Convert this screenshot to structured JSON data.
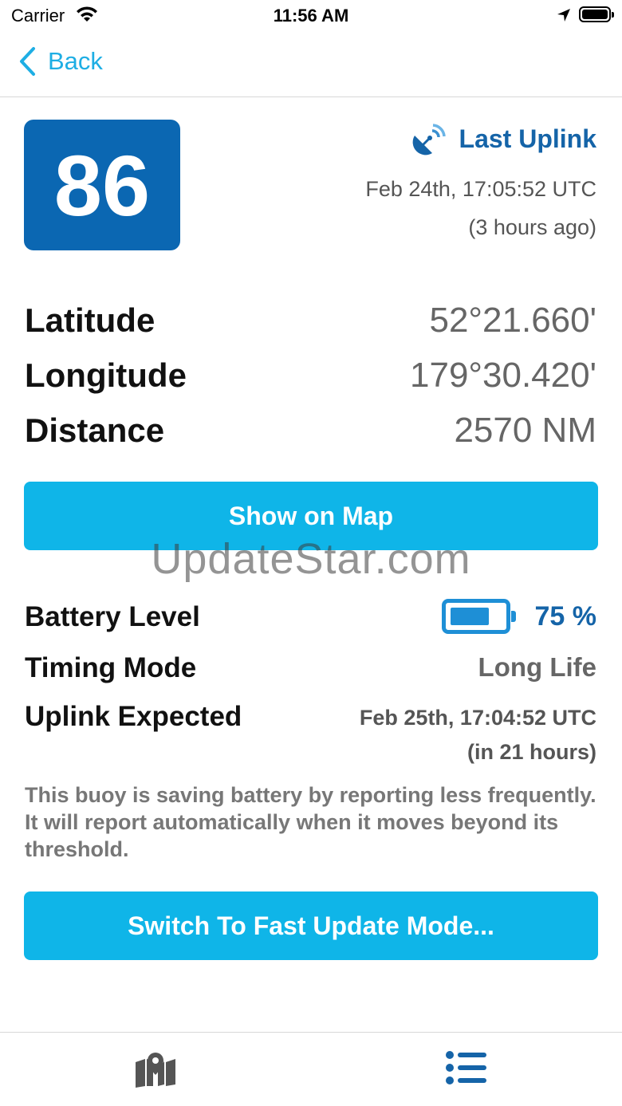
{
  "status_bar": {
    "carrier": "Carrier",
    "time": "11:56 AM"
  },
  "nav": {
    "back_label": "Back"
  },
  "buoy": {
    "number": "86"
  },
  "uplink": {
    "heading": "Last Uplink",
    "time": "Feb 24th, 17:05:52 UTC",
    "ago": "(3 hours ago)"
  },
  "position": {
    "latitude_label": "Latitude",
    "latitude_value": "52°21.660'",
    "longitude_label": "Longitude",
    "longitude_value": "179°30.420'",
    "distance_label": "Distance",
    "distance_value": "2570 NM"
  },
  "show_map_label": "Show on Map",
  "watermark": "UpdateStar.com",
  "battery": {
    "label": "Battery Level",
    "value": "75 %",
    "level": 0.75
  },
  "timing": {
    "label": "Timing Mode",
    "value": "Long Life"
  },
  "expected": {
    "label": "Uplink Expected",
    "time": "Feb 25th, 17:04:52 UTC",
    "in": "(in 21 hours)"
  },
  "note": "This buoy is saving battery by reporting less frequently. It will report automatically when it moves beyond its threshold.",
  "fast_mode_label": "Switch To Fast Update Mode...",
  "tabs": [
    {
      "icon": "map-pin-icon",
      "selected": false
    },
    {
      "icon": "list-icon",
      "selected": true
    }
  ],
  "colors": {
    "accent": "#0fb5e8",
    "badge": "#0b67b2",
    "link": "#1eaee4",
    "dark_blue": "#1564a8"
  }
}
